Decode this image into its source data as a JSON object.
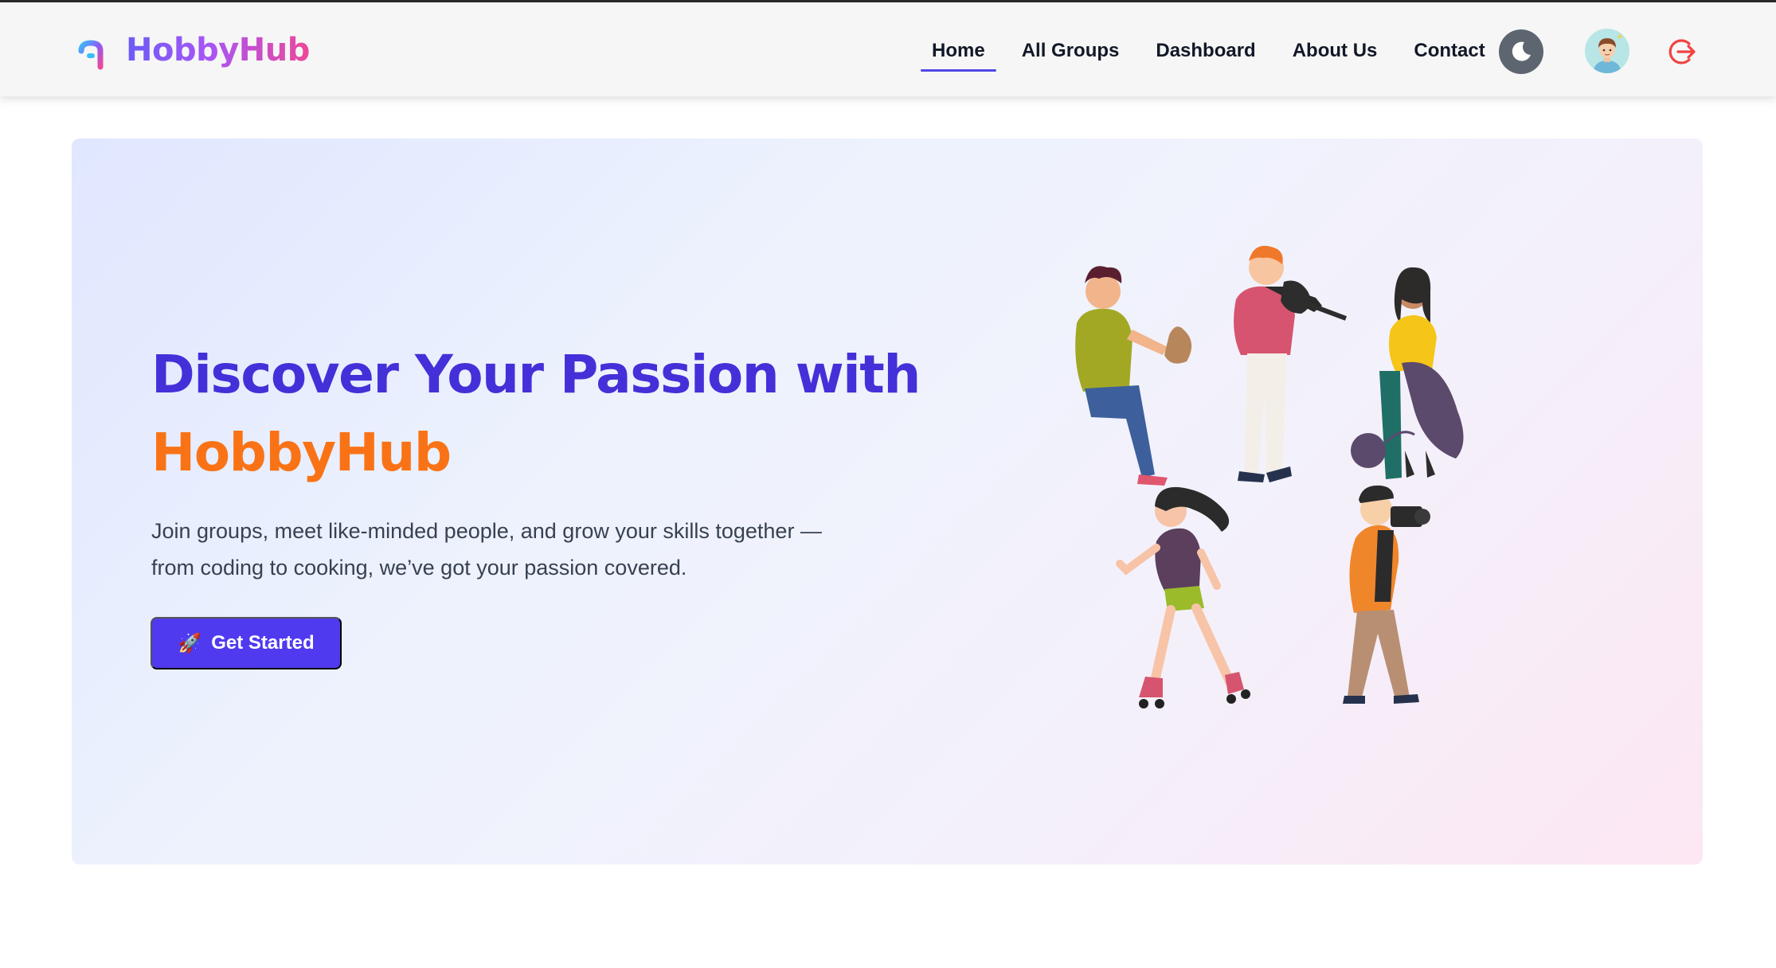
{
  "app": {
    "brand_name": "HobbyHub",
    "brand_colors": [
      "#6b5cf6",
      "#a855f7",
      "#ec4899"
    ]
  },
  "nav": {
    "items": [
      {
        "label": "Home",
        "active": true
      },
      {
        "label": "All Groups",
        "active": false
      },
      {
        "label": "Dashboard",
        "active": false
      },
      {
        "label": "About Us",
        "active": false
      },
      {
        "label": "Contact",
        "active": false
      }
    ],
    "theme_toggle_icon": "moon-icon",
    "avatar_icon": "user-avatar",
    "logout_icon": "logout-icon",
    "accent_color": "#4f46e5",
    "logout_color": "#ef4444"
  },
  "hero": {
    "title_line1": "Discover Your Passion with",
    "title_line2": "HobbyHub",
    "description": "Join groups, meet like-minded people, and grow your skills together — from coding to cooking, we’ve got your passion covered.",
    "cta_icon": "🚀",
    "cta_label": "Get Started",
    "title_color": "#4430d8",
    "highlight_color": "#f97316",
    "cta_color": "#4f3af0",
    "illustration_icon": "hobby-people-illustration"
  }
}
